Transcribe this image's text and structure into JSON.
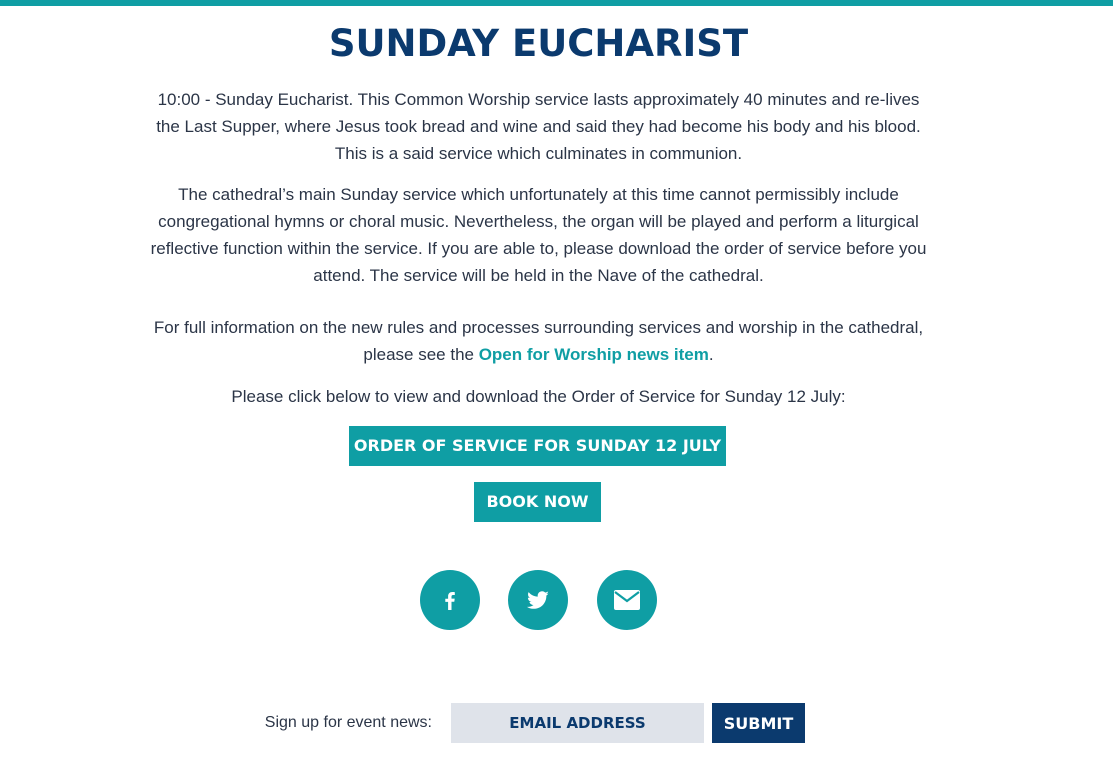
{
  "page": {
    "title": "SUNDAY EUCHARIST",
    "paragraph1": "10:00 - Sunday Eucharist. This Common Worship service lasts approximately 40 minutes and re-lives the Last Supper, where Jesus took bread and wine and said they had become his body and his blood. This is a said service which culminates in communion.",
    "paragraph2": "The cathedral’s main Sunday service which unfortunately at this time cannot permissibly include congregational hymns or choral music. Nevertheless, the organ will be played and perform a liturgical reflective function within the service. If you are able to, please download the order of service before you attend. The service will be held in the Nave of the cathedral.",
    "paragraph3_before": "For full information on the new rules and processes surrounding services and worship in the cathedral, please see the ",
    "paragraph3_link": "Open for Worship news item",
    "paragraph3_after": ".",
    "paragraph4": "Please click below to view and download the Order of Service for Sunday 12 July:"
  },
  "buttons": {
    "order_of_service": "ORDER OF SERVICE FOR SUNDAY 12 JULY",
    "book_now": "BOOK NOW"
  },
  "social": {
    "facebook_icon": "facebook-icon",
    "twitter_icon": "twitter-icon",
    "email_icon": "email-icon"
  },
  "signup": {
    "label": "Sign up for event news:",
    "email_placeholder": "EMAIL ADDRESS",
    "submit_label": "SUBMIT"
  },
  "colors": {
    "accent": "#0f9ea4",
    "navy": "#0b3a6e",
    "input_bg": "#dfe3ea"
  }
}
